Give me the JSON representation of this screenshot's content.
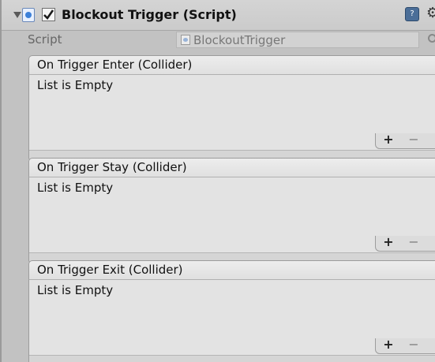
{
  "component": {
    "title": "Blockout Trigger (Script)",
    "enabled": true,
    "icons": [
      "script-icon",
      "help-icon",
      "gear-icon"
    ]
  },
  "script_field": {
    "label": "Script",
    "value": "BlockoutTrigger"
  },
  "events": [
    {
      "header": "On Trigger Enter (Collider)",
      "empty_text": "List is Empty",
      "add_label": "+",
      "remove_label": "−"
    },
    {
      "header": "On Trigger Stay (Collider)",
      "empty_text": "List is Empty",
      "add_label": "+",
      "remove_label": "−"
    },
    {
      "header": "On Trigger Exit (Collider)",
      "empty_text": "List is Empty",
      "add_label": "+",
      "remove_label": "−"
    }
  ],
  "colors": {
    "background": "#c2c2c2",
    "header_bg": "#cbcbcb",
    "list_bg": "#e3e3e3",
    "text": "#111111",
    "muted_text": "#666666"
  }
}
